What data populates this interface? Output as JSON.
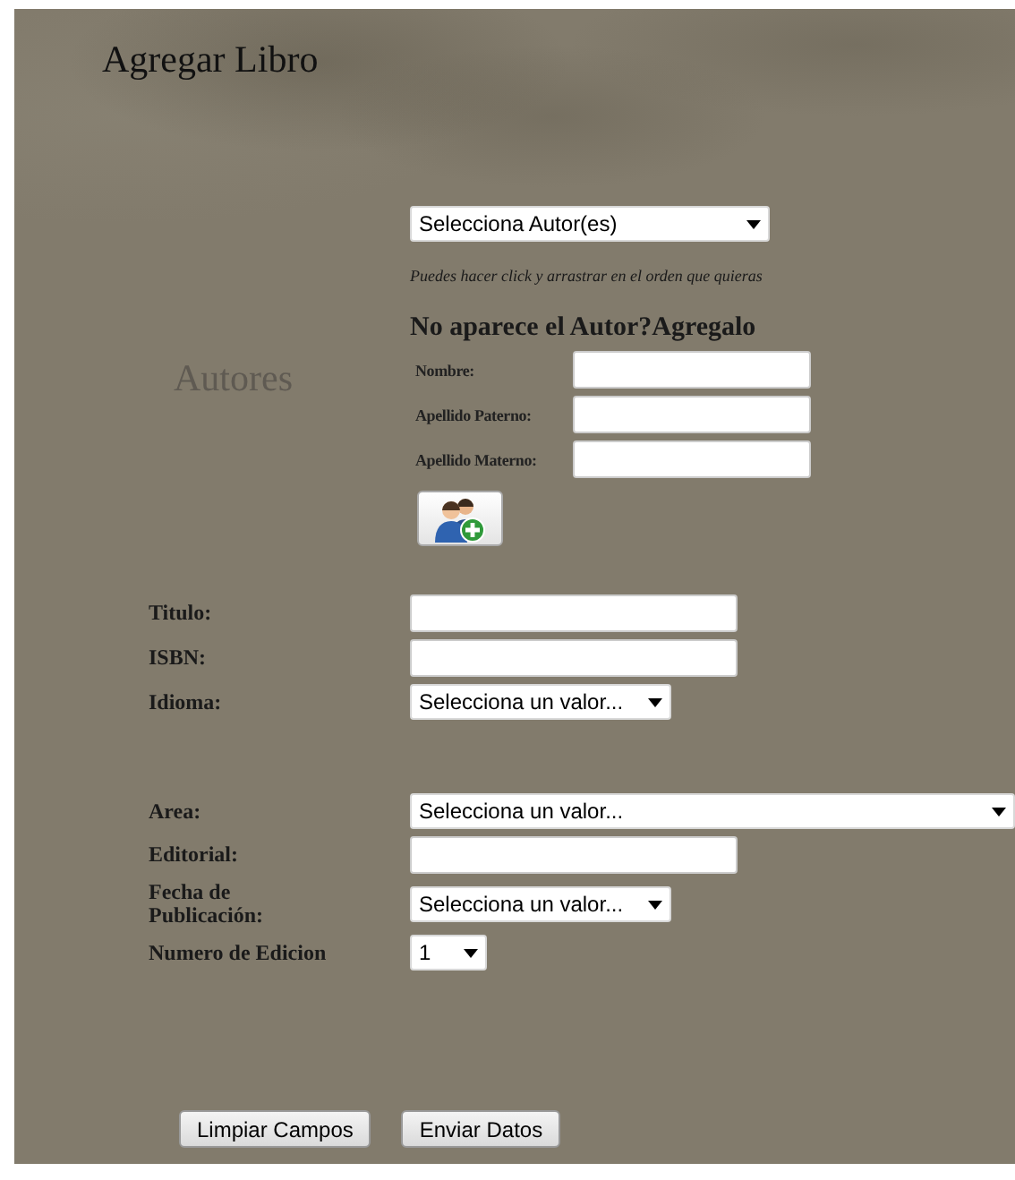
{
  "title": "Agregar Libro",
  "authors": {
    "label": "Autores",
    "select": {
      "value": "Selecciona Autor(es)"
    },
    "hint": "Puedes hacer click y arrastrar en el orden que quieras",
    "heading": "No aparece el Autor?Agregalo",
    "fields": [
      {
        "label": "Nombre:"
      },
      {
        "label": "Apellido Paterno:"
      },
      {
        "label": "Apellido Materno:"
      }
    ]
  },
  "sections": [
    {
      "fields": [
        {
          "kind": "text",
          "label": "Titulo:"
        },
        {
          "kind": "text",
          "label": "ISBN:"
        },
        {
          "kind": "select",
          "label": "Idioma:",
          "value": "Selecciona un valor..."
        }
      ]
    },
    {
      "fields": [
        {
          "kind": "select",
          "label": "Area:",
          "value": "Selecciona un valor..."
        },
        {
          "kind": "text",
          "label": "Editorial:"
        },
        {
          "kind": "select",
          "label": "Fecha de Publicación:",
          "value": "Selecciona un valor..."
        },
        {
          "kind": "select",
          "label": "Numero de Edicion",
          "value": "1"
        }
      ]
    }
  ],
  "buttons": [
    "Limpiar Campos",
    "Enviar Datos"
  ]
}
